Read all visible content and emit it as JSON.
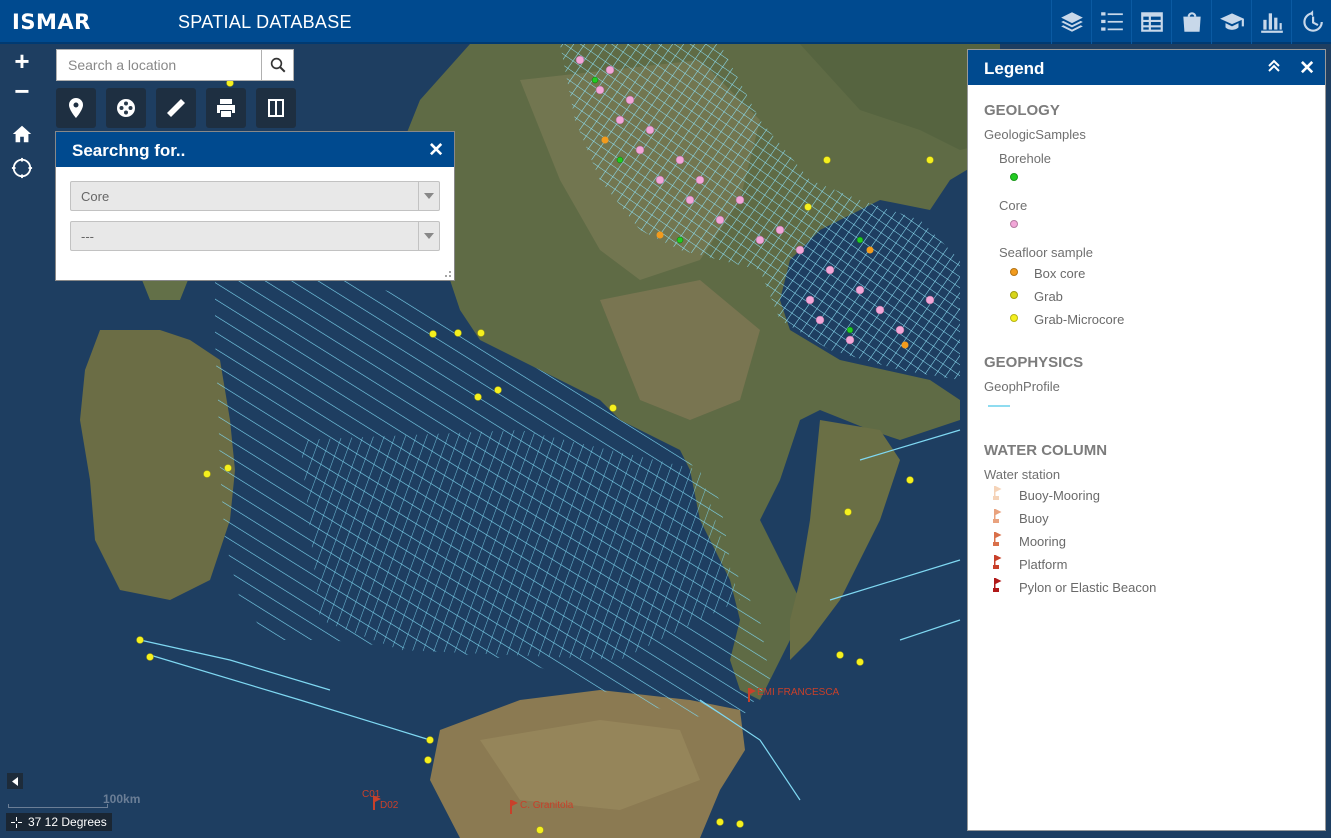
{
  "header": {
    "app_name": "ISMAR",
    "subtitle": "SPATIAL DATABASE",
    "tools": [
      {
        "icon": "layers-icon"
      },
      {
        "icon": "legend-list-icon"
      },
      {
        "icon": "table-icon"
      },
      {
        "icon": "basemap-icon"
      },
      {
        "icon": "education-icon"
      },
      {
        "icon": "chart-icon"
      },
      {
        "icon": "history-icon"
      }
    ]
  },
  "map_controls": {
    "zoom_in": "+",
    "zoom_out": "−",
    "search_placeholder": "Search a location",
    "toolbar": [
      "location-pin-icon",
      "film-reel-icon",
      "ruler-icon",
      "print-icon",
      "split-view-icon"
    ]
  },
  "search_panel": {
    "title": "Searchng for..",
    "close": "✕",
    "select1_value": "Core",
    "select2_value": "---"
  },
  "legend": {
    "title": "Legend",
    "close": "✕",
    "sections": [
      {
        "label": "GEOLOGY"
      },
      {
        "label": "GEOPHYSICS"
      },
      {
        "label": "WATER COLUMN"
      }
    ],
    "geology_layer": "GeologicSamples",
    "borehole": {
      "label": "Borehole",
      "color": "#22cc22"
    },
    "core": {
      "label": "Core",
      "color": "#f2a6d8"
    },
    "seafloor": {
      "label": "Seafloor sample"
    },
    "box_core": {
      "label": "Box core",
      "color": "#f29b1d"
    },
    "grab": {
      "label": "Grab",
      "color": "#d8d51a"
    },
    "grab_microcore": {
      "label": "Grab-Microcore",
      "color": "#f5f01e"
    },
    "geoph_layer": "GeophProfile",
    "geoph_color": "#8fdcf0",
    "water_layer": "Water station",
    "stations": [
      {
        "label": "Buoy-Mooring",
        "color": "#f5d3b8"
      },
      {
        "label": "Buoy",
        "color": "#e9a27e"
      },
      {
        "label": "Mooring",
        "color": "#d9704a"
      },
      {
        "label": "Platform",
        "color": "#c8402a"
      },
      {
        "label": "Pylon or Elastic Beacon",
        "color": "#b01818"
      }
    ]
  },
  "map_labels": {
    "label_a": "C. Granitola",
    "label_b": "C01",
    "label_c": "EMI FRANCESCA",
    "label_d": "D02"
  },
  "footer": {
    "scale": "100km",
    "coords": "37 12 Degrees"
  }
}
